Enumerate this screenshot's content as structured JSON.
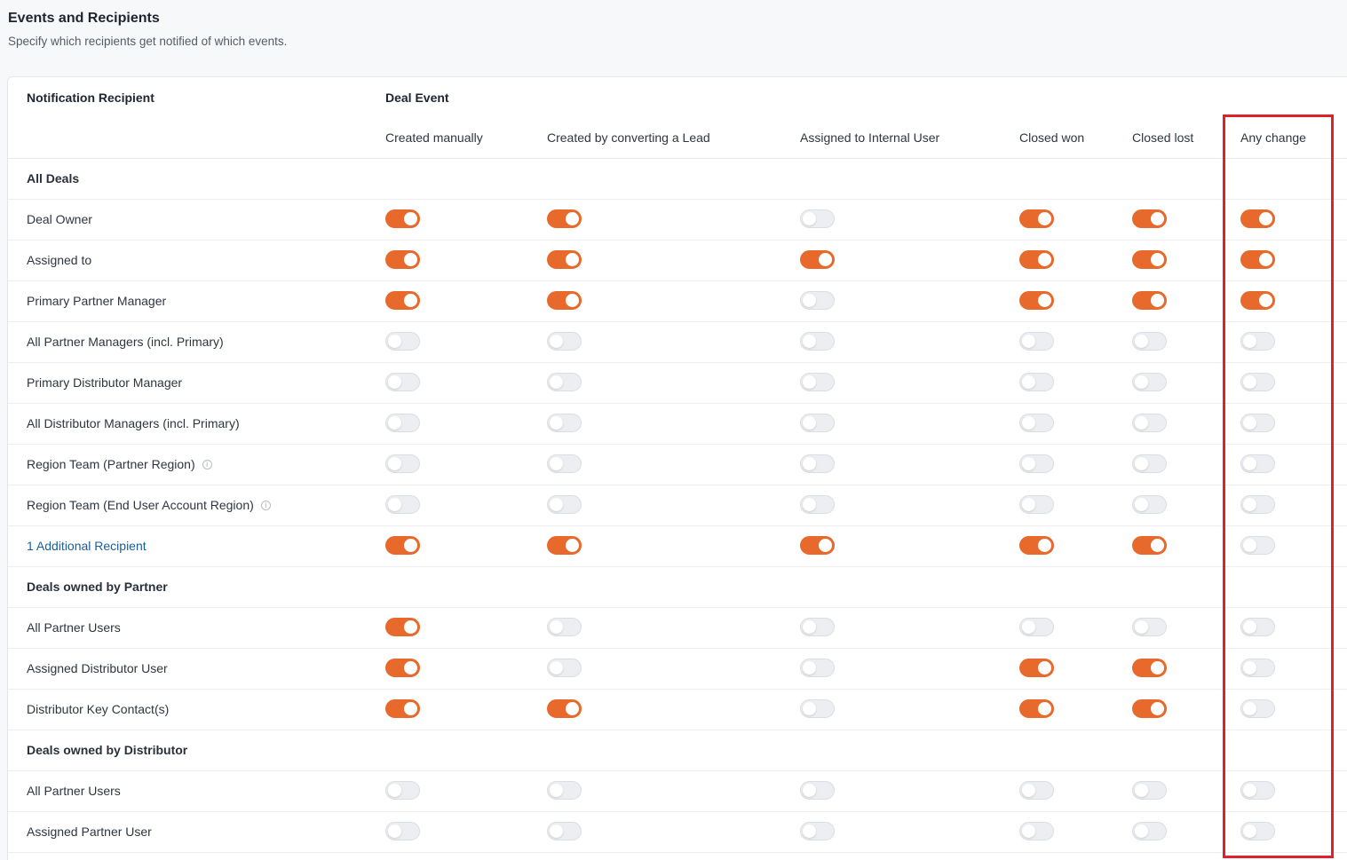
{
  "header": {
    "title": "Events and Recipients",
    "subtitle": "Specify which recipients get notified of which events."
  },
  "table": {
    "recipient_header": "Notification Recipient",
    "event_header": "Deal Event",
    "columns": [
      "Created manually",
      "Created by converting a Lead",
      "Assigned to Internal User",
      "Closed won",
      "Closed lost",
      "Any change"
    ],
    "rows": [
      {
        "type": "group",
        "label": "All Deals"
      },
      {
        "type": "row",
        "label": "Deal Owner",
        "toggles": [
          true,
          true,
          false,
          true,
          true,
          true
        ]
      },
      {
        "type": "row",
        "label": "Assigned to",
        "toggles": [
          true,
          true,
          true,
          true,
          true,
          true
        ]
      },
      {
        "type": "row",
        "label": "Primary Partner Manager",
        "toggles": [
          true,
          true,
          false,
          true,
          true,
          true
        ]
      },
      {
        "type": "row",
        "label": "All Partner Managers (incl. Primary)",
        "toggles": [
          false,
          false,
          false,
          false,
          false,
          false
        ]
      },
      {
        "type": "row",
        "label": "Primary Distributor Manager",
        "toggles": [
          false,
          false,
          false,
          false,
          false,
          false
        ]
      },
      {
        "type": "row",
        "label": "All Distributor Managers (incl. Primary)",
        "toggles": [
          false,
          false,
          false,
          false,
          false,
          false
        ]
      },
      {
        "type": "row",
        "label": "Region Team (Partner Region)",
        "info": true,
        "toggles": [
          false,
          false,
          false,
          false,
          false,
          false
        ]
      },
      {
        "type": "row",
        "label": "Region Team (End User Account Region)",
        "info": true,
        "toggles": [
          false,
          false,
          false,
          false,
          false,
          false
        ]
      },
      {
        "type": "row",
        "label": "1 Additional Recipient",
        "link": true,
        "toggles": [
          true,
          true,
          true,
          true,
          true,
          false
        ]
      },
      {
        "type": "group",
        "label": "Deals owned by Partner"
      },
      {
        "type": "row",
        "label": "All Partner Users",
        "toggles": [
          true,
          false,
          false,
          false,
          false,
          false
        ]
      },
      {
        "type": "row",
        "label": "Assigned Distributor User",
        "toggles": [
          true,
          false,
          false,
          true,
          true,
          false
        ]
      },
      {
        "type": "row",
        "label": "Distributor Key Contact(s)",
        "toggles": [
          true,
          true,
          false,
          true,
          true,
          false
        ]
      },
      {
        "type": "group",
        "label": "Deals owned by Distributor"
      },
      {
        "type": "row",
        "label": "All Partner Users",
        "toggles": [
          false,
          false,
          false,
          false,
          false,
          false
        ]
      },
      {
        "type": "row",
        "label": "Assigned Partner User",
        "toggles": [
          false,
          false,
          false,
          false,
          false,
          false
        ]
      }
    ]
  },
  "icons": {
    "info": "info-icon"
  },
  "colors": {
    "toggle_on": "#e8692c",
    "toggle_off": "#eceef1",
    "highlight": "#e0212b",
    "link": "#1a5e9a"
  },
  "highlight": {
    "column": "Any change"
  }
}
